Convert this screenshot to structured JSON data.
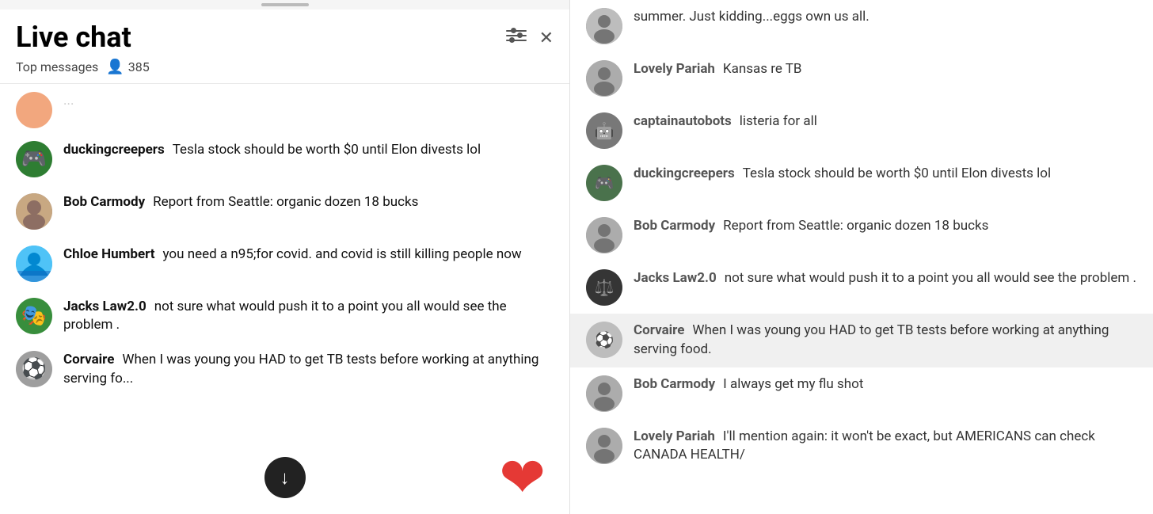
{
  "header": {
    "title": "Live chat",
    "top_messages_label": "Top messages",
    "viewer_count": "385"
  },
  "left_chat": [
    {
      "username": "duckingcreepers",
      "message": "Tesla stock should be worth $0 until Elon divests lol",
      "avatar_style": "av-green",
      "avatar_glyph": "🎮"
    },
    {
      "username": "Bob Carmody",
      "message": "Report from Seattle: organic dozen 18 bucks",
      "avatar_style": "av-tan",
      "avatar_glyph": "👤"
    },
    {
      "username": "Chloe Humbert",
      "message": "you need a n95;for covid. and covid is still killing people now",
      "avatar_style": "av-blue",
      "avatar_glyph": "🌊"
    },
    {
      "username": "Jacks Law2.0",
      "message": "not sure what would push it to a point you all would see the problem .",
      "avatar_style": "av-multi",
      "avatar_glyph": "🎭"
    },
    {
      "username": "Corvaire",
      "message": "When I was young you HAD to get TB tests before working at anything serving fo...",
      "avatar_style": "av-gray",
      "avatar_glyph": "⚽"
    }
  ],
  "right_chat": [
    {
      "username": "",
      "message": "summer. Just kidding...eggs own us all.",
      "avatar_style": "av-gray",
      "avatar_glyph": "👤",
      "show_avatar": true
    },
    {
      "username": "Lovely Pariah",
      "message": "Kansas re TB",
      "avatar_style": "av-tan",
      "avatar_glyph": "👤",
      "show_avatar": true
    },
    {
      "username": "captainautobots",
      "message": "listeria for all",
      "avatar_style": "av-teal",
      "avatar_glyph": "🤖",
      "show_avatar": true
    },
    {
      "username": "duckingcreepers",
      "message": "Tesla stock should be worth $0 until Elon divests lol",
      "avatar_style": "av-green",
      "avatar_glyph": "🎮",
      "show_avatar": true
    },
    {
      "username": "Bob Carmody",
      "message": "Report from Seattle: organic dozen 18 bucks",
      "avatar_style": "av-tan",
      "avatar_glyph": "👤",
      "show_avatar": true
    },
    {
      "username": "Jacks Law2.0",
      "message": "not sure what would push it to a point you all would see the problem .",
      "avatar_style": "av-purple",
      "avatar_glyph": "⚖️",
      "show_avatar": true
    },
    {
      "username": "Corvaire",
      "message": "When I was young you HAD to get TB tests before working at anything serving food.",
      "avatar_style": "av-gray",
      "avatar_glyph": "⚽",
      "show_avatar": true,
      "highlighted": true
    },
    {
      "username": "Bob Carmody",
      "message": "I always get my flu shot",
      "avatar_style": "av-tan",
      "avatar_glyph": "👤",
      "show_avatar": true
    },
    {
      "username": "Lovely Pariah",
      "message": "I'll mention again: it won't be exact, but AMERICANS can check CANADA HEALTH/",
      "avatar_style": "av-tan",
      "avatar_glyph": "👤",
      "show_avatar": true
    }
  ]
}
